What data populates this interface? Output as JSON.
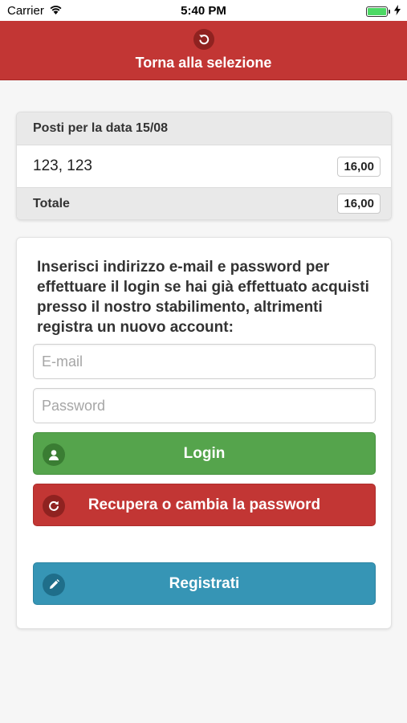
{
  "status_bar": {
    "carrier": "Carrier",
    "time": "5:40 PM",
    "wifi_icon": "wifi-icon",
    "battery_icon": "battery-icon",
    "charging_icon": "bolt-icon"
  },
  "header": {
    "back_label": "Torna alla selezione",
    "back_icon": "undo-icon",
    "color": "#c23634"
  },
  "summary": {
    "title": "Posti per la data 15/08",
    "rows": [
      {
        "seats": "123, 123",
        "price": "16,00"
      }
    ],
    "total_label": "Totale",
    "total_value": "16,00"
  },
  "login": {
    "instructions": "Inserisci indirizzo e-mail e password per effettuare il login se hai già effettuato acquisti presso il nostro stabilimento, altrimenti registra un nuovo account:",
    "email_placeholder": "E-mail",
    "password_placeholder": "Password",
    "login_label": "Login",
    "login_icon": "user-icon",
    "login_color": "#55a44c",
    "recover_label": "Recupera o cambia la password",
    "recover_icon": "refresh-icon",
    "recover_color": "#c23634",
    "register_label": "Registrati",
    "register_icon": "pencil-icon",
    "register_color": "#3695b5"
  }
}
